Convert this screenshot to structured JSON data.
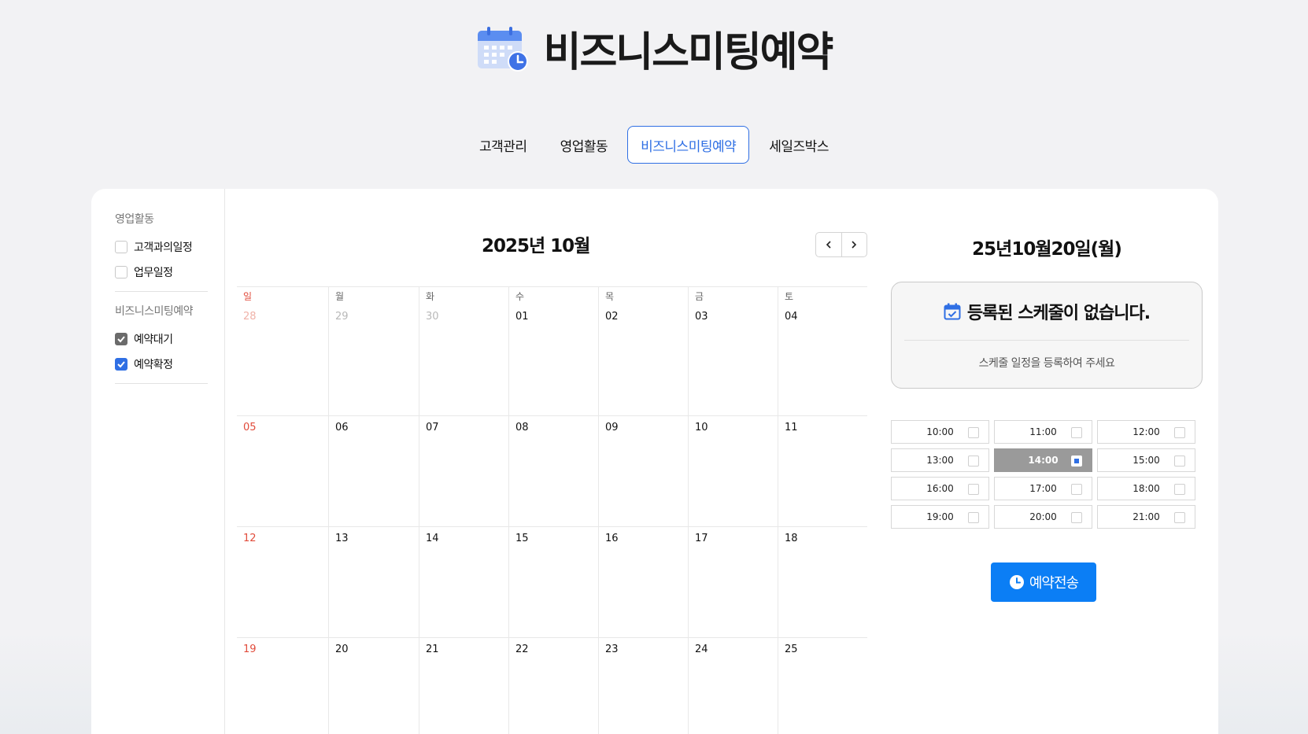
{
  "header": {
    "title": "비즈니스미팅예약",
    "icon": "calendar-clock-icon"
  },
  "tabs": [
    {
      "label": "고객관리",
      "active": false
    },
    {
      "label": "영업활동",
      "active": false
    },
    {
      "label": "비즈니스미팅예약",
      "active": true
    },
    {
      "label": "세일즈박스",
      "active": false
    }
  ],
  "sidebar": {
    "groups": [
      {
        "title": "영업활동",
        "items": [
          {
            "label": "고객과의일정",
            "checked": false
          },
          {
            "label": "업무일정",
            "checked": false
          }
        ]
      },
      {
        "title": "비즈니스미팅예약",
        "items": [
          {
            "label": "예약대기",
            "checked": true,
            "color": "#6b6b6b"
          },
          {
            "label": "예약확정",
            "checked": true,
            "color": "#2f6fe4"
          }
        ]
      }
    ]
  },
  "calendar": {
    "title": "2025년 10월",
    "weekdays": [
      "일",
      "월",
      "화",
      "수",
      "목",
      "금",
      "토"
    ],
    "weeks": [
      [
        "28",
        "29",
        "30",
        "01",
        "02",
        "03",
        "04"
      ],
      [
        "05",
        "06",
        "07",
        "08",
        "09",
        "10",
        "11"
      ],
      [
        "12",
        "13",
        "14",
        "15",
        "16",
        "17",
        "18"
      ],
      [
        "19",
        "20",
        "21",
        "22",
        "23",
        "24",
        "25"
      ]
    ],
    "prev_icon": "chevron-left-icon",
    "next_icon": "chevron-right-icon"
  },
  "detail": {
    "date_title": "25년10월20일(월)",
    "empty_title": "등록된 스케줄이 없습니다.",
    "empty_sub": "스케줄 일정을 등록하여 주세요",
    "time_slots": [
      {
        "time": "10:00",
        "selected": false
      },
      {
        "time": "11:00",
        "selected": false
      },
      {
        "time": "12:00",
        "selected": false
      },
      {
        "time": "13:00",
        "selected": false
      },
      {
        "time": "14:00",
        "selected": true
      },
      {
        "time": "15:00",
        "selected": false
      },
      {
        "time": "16:00",
        "selected": false
      },
      {
        "time": "17:00",
        "selected": false
      },
      {
        "time": "18:00",
        "selected": false
      },
      {
        "time": "19:00",
        "selected": false
      },
      {
        "time": "20:00",
        "selected": false
      },
      {
        "time": "21:00",
        "selected": false
      }
    ],
    "send_label": "예약전송"
  },
  "colors": {
    "accent": "#2f6fe4",
    "send_button": "#0b7ef5",
    "sunday": "#e14b3b"
  }
}
